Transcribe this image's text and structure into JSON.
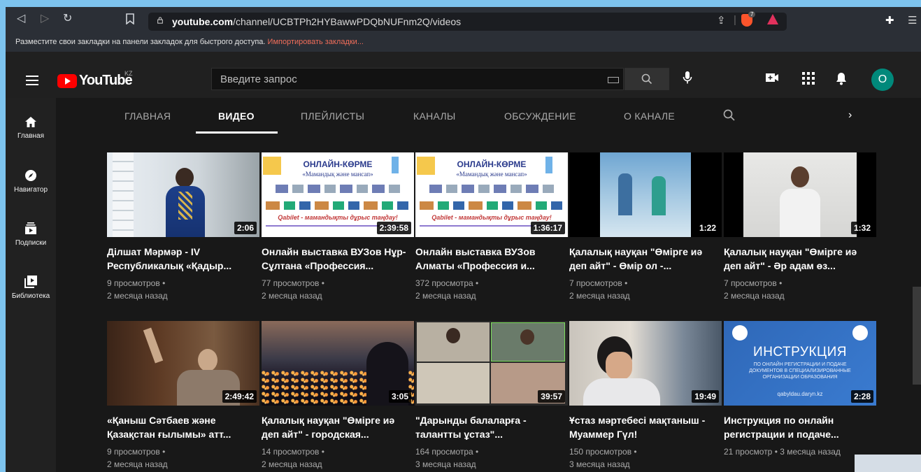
{
  "browser": {
    "url_domain": "youtube.com",
    "url_path": "/channel/UCBTPh2HYBawwPDQbNUFnm2Q/videos",
    "bookmarks_text": "Разместите свои закладки на панели закладок для быстрого доступа.",
    "bookmarks_import": "Импортировать закладки...",
    "brave_badge": "7"
  },
  "header": {
    "logo_text": "YouTube",
    "country": "KZ",
    "search_placeholder": "Введите запрос",
    "avatar_letter": "О"
  },
  "guide": [
    {
      "label": "Главная",
      "icon": "home-icon"
    },
    {
      "label": "Навигатор",
      "icon": "compass-icon"
    },
    {
      "label": "Подписки",
      "icon": "subscriptions-icon"
    },
    {
      "label": "Библиотека",
      "icon": "library-icon"
    }
  ],
  "tabs": [
    "ГЛАВНАЯ",
    "ВИДЕО",
    "ПЛЕЙЛИСТЫ",
    "КАНАЛЫ",
    "ОБСУЖДЕНИЕ",
    "О КАНАЛЕ"
  ],
  "active_tab": "ВИДЕО",
  "videos": [
    {
      "title": "Ділшат Мәрмәр - IV Республикалық «Қадыр...",
      "views": "9 просмотров •",
      "age": "2 месяца назад",
      "duration": "2:06"
    },
    {
      "title": "Онлайн выставка ВУЗов Нұр-Сұлтана «Профессия...",
      "views": "77 просмотров •",
      "age": "2 месяца назад",
      "duration": "2:39:58",
      "poster": {
        "title": "ОНЛАЙН-КӨРМЕ",
        "subtitle": "«Мамандық және мансап»",
        "caption": "Qabilet - мамандықты дұрыс таңдау!"
      }
    },
    {
      "title": "Онлайн выставка ВУЗов Алматы «Профессия и...",
      "views": "372 просмотра •",
      "age": "2 месяца назад",
      "duration": "1:36:17",
      "poster": {
        "title": "ОНЛАЙН-КӨРМЕ",
        "subtitle": "«Мамандық және мансап»",
        "caption": "Qabilet - мамандықты дұрыс таңдау!"
      }
    },
    {
      "title": "Қалалық науқан \"Өмірге иә деп айт\" - Өмір ол -...",
      "views": "7 просмотров •",
      "age": "2 месяца назад",
      "duration": "1:22"
    },
    {
      "title": "Қалалық науқан \"Өмірге иә деп айт\" - Әр адам өз...",
      "views": "7 просмотров •",
      "age": "2 месяца назад",
      "duration": "1:32"
    },
    {
      "title": "«Қаныш Сәтбаев және Қазақстан ғылымы» атт...",
      "views": "9 просмотров •",
      "age": "2 месяца назад",
      "duration": "2:49:42"
    },
    {
      "title": "Қалалық науқан \"Өмірге иә деп айт\" - городская...",
      "views": "14 просмотров •",
      "age": "2 месяца назад",
      "duration": "3:05"
    },
    {
      "title": "\"Дарынды балаларға - талантты ұстаз\"...",
      "views": "164 просмотра •",
      "age": "3 месяца назад",
      "duration": "39:57"
    },
    {
      "title": "Ұстаз мәртебесі мақтаныш - Муаммер Гүл!",
      "views": "150 просмотров •",
      "age": "3 месяца назад",
      "duration": "19:49"
    },
    {
      "title": "Инструкция по онлайн регистрации и подаче...",
      "views": "21 просмотр • 3 месяца назад",
      "age": "",
      "duration": "2:28",
      "poster": {
        "title": "ИНСТРУКЦИЯ",
        "subtitle": "ПО ОНЛАЙН РЕГИСТРАЦИИ И ПОДАЧЕ ДОКУМЕНТОВ В СПЕЦИАЛИЗИРОВАННЫЕ ОРГАНИЗАЦИИ ОБРАЗОВАНИЯ",
        "caption": "qabyldau.daryn.kz"
      }
    }
  ],
  "colors": {
    "brand": "#ff0000",
    "avatar": "#00897b",
    "bg": "#181818"
  }
}
